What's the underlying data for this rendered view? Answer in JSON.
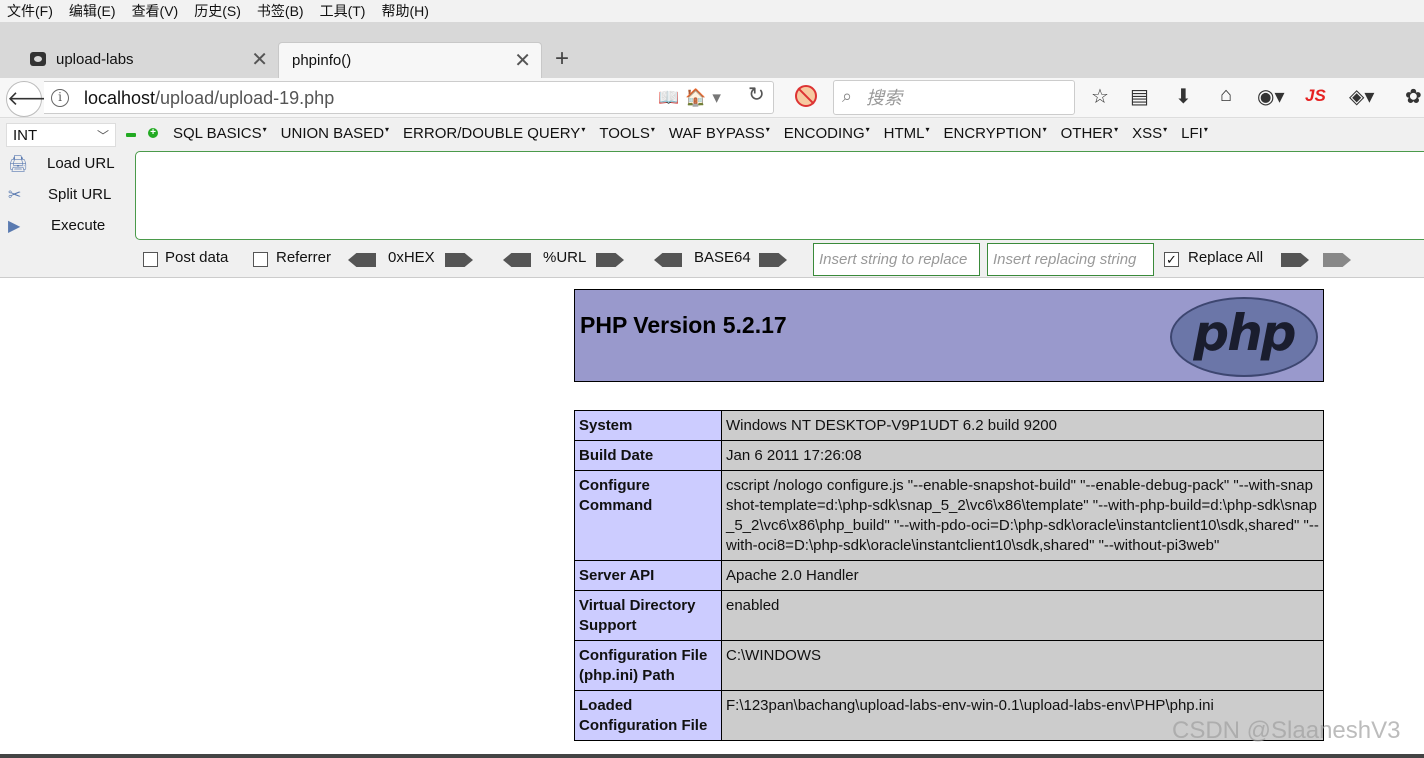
{
  "menubar": {
    "items": [
      "文件(F)",
      "编辑(E)",
      "查看(V)",
      "历史(S)",
      "书签(B)",
      "工具(T)",
      "帮助(H)"
    ]
  },
  "tabs": [
    {
      "label": "upload-labs",
      "active": false
    },
    {
      "label": "phpinfo()",
      "active": true
    }
  ],
  "navbar": {
    "url_host": "localhost",
    "url_path": "/upload/upload-19.php",
    "search_placeholder": "搜索",
    "js_badge": "JS"
  },
  "hackbar": {
    "type_select": "INT",
    "menus": [
      "SQL BASICS",
      "UNION BASED",
      "ERROR/DOUBLE QUERY",
      "TOOLS",
      "WAF BYPASS",
      "ENCODING",
      "HTML",
      "ENCRYPTION",
      "OTHER",
      "XSS",
      "LFI"
    ],
    "load_url": "Load URL",
    "split_url": "Split URL",
    "execute": "Execute",
    "post_data": "Post data",
    "referrer": "Referrer",
    "hex": "0xHEX",
    "url_enc": "%URL",
    "base64": "BASE64",
    "replace_placeholder": "Insert string to replace",
    "replacing_placeholder": "Insert replacing string",
    "replace_all": "Replace All",
    "replace_all_checked": true
  },
  "phpinfo": {
    "version_title": "PHP Version 5.2.17",
    "logo_text": "php",
    "rows": [
      {
        "key": "System",
        "value": "Windows NT DESKTOP-V9P1UDT 6.2 build 9200"
      },
      {
        "key": "Build Date",
        "value": "Jan 6 2011 17:26:08"
      },
      {
        "key": "Configure Command",
        "value": "cscript /nologo configure.js \"--enable-snapshot-build\" \"--enable-debug-pack\" \"--with-snapshot-template=d:\\php-sdk\\snap_5_2\\vc6\\x86\\template\" \"--with-php-build=d:\\php-sdk\\snap_5_2\\vc6\\x86\\php_build\" \"--with-pdo-oci=D:\\php-sdk\\oracle\\instantclient10\\sdk,shared\" \"--with-oci8=D:\\php-sdk\\oracle\\instantclient10\\sdk,shared\" \"--without-pi3web\""
      },
      {
        "key": "Server API",
        "value": "Apache 2.0 Handler"
      },
      {
        "key": "Virtual Directory Support",
        "value": "enabled"
      },
      {
        "key": "Configuration File (php.ini) Path",
        "value": "C:\\WINDOWS"
      },
      {
        "key": "Loaded Configuration File",
        "value": "F:\\123pan\\bachang\\upload-labs-env-win-0.1\\upload-labs-env\\PHP\\php.ini"
      }
    ]
  },
  "watermark": "CSDN @SlaaneshV3"
}
